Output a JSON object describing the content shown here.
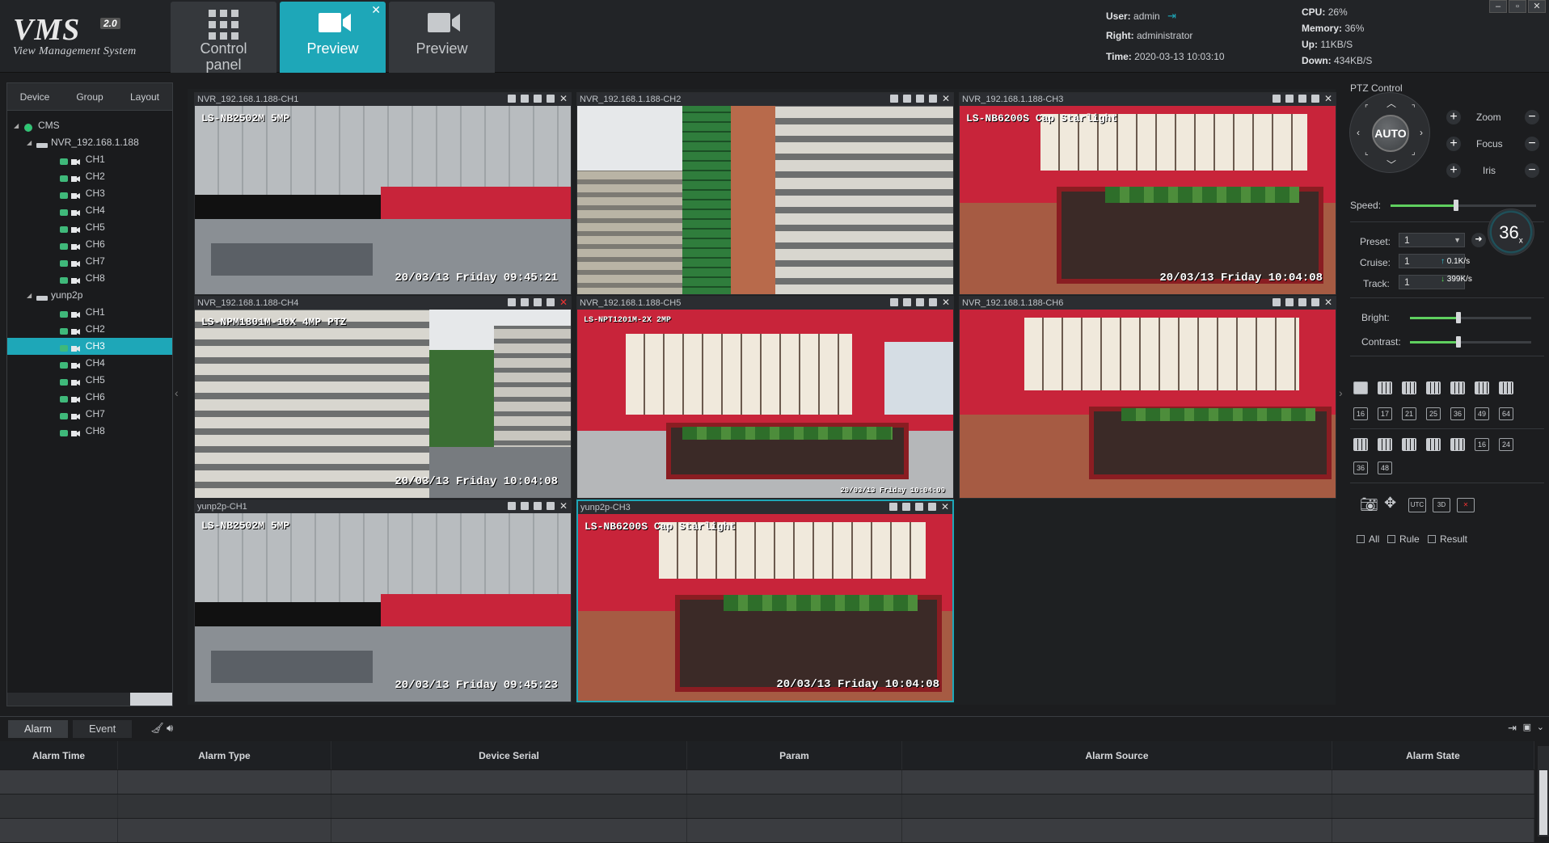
{
  "app": {
    "logo_main": "VMS",
    "logo_version": "2.0",
    "logo_sub": "View Management System"
  },
  "nav": {
    "tabs": [
      {
        "label": "Control panel",
        "icon": "grid-icon"
      },
      {
        "label": "Preview",
        "icon": "camera-icon",
        "active": true,
        "closable": true
      },
      {
        "label": "Preview",
        "icon": "camera-icon"
      }
    ]
  },
  "session": {
    "user_label": "User:",
    "user_value": "admin",
    "right_label": "Right:",
    "right_value": "administrator",
    "time_label": "Time:",
    "time_value": "2020-03-13 10:03:10"
  },
  "stats": {
    "cpu_label": "CPU:",
    "cpu_value": "26%",
    "memory_label": "Memory:",
    "memory_value": "36%",
    "up_label": "Up:",
    "up_value": "11KB/S",
    "down_label": "Down:",
    "down_value": "434KB/S"
  },
  "left_panel": {
    "tabs": [
      "Device",
      "Group",
      "Layout"
    ],
    "tree": {
      "root": "CMS",
      "devices": [
        {
          "name": "NVR_192.168.1.188",
          "channels": [
            "CH1",
            "CH2",
            "CH3",
            "CH4",
            "CH5",
            "CH6",
            "CH7",
            "CH8"
          ]
        },
        {
          "name": "yunp2p",
          "channels": [
            "CH1",
            "CH2",
            "CH3",
            "CH4",
            "CH5",
            "CH6",
            "CH7",
            "CH8"
          ],
          "selected": "CH3"
        }
      ]
    }
  },
  "video": {
    "cells": [
      {
        "title": "NVR_192.168.1.188-CH1",
        "osd_top": "LS-NB2502M  5MP",
        "osd_time": "20/03/13 Friday 09:45:21"
      },
      {
        "title": "NVR_192.168.1.188-CH2",
        "osd_top": "",
        "osd_time": ""
      },
      {
        "title": "NVR_192.168.1.188-CH3",
        "osd_top": "LS-NB6200S Cap Starlight",
        "osd_time": "20/03/13 Friday 10:04:08"
      },
      {
        "title": "NVR_192.168.1.188-CH4",
        "osd_top": "LS-NPM1801M-10X 4MP PTZ",
        "osd_time": "20/03/13 Friday 10:04:08"
      },
      {
        "title": "NVR_192.168.1.188-CH5",
        "osd_top": "LS-NPT1201M-2X 2MP",
        "osd_time": "20/03/13 Friday 10:04:09"
      },
      {
        "title": "NVR_192.168.1.188-CH6",
        "osd_top": "",
        "osd_time": ""
      },
      {
        "title": "yunp2p-CH1",
        "osd_top": "LS-NB2502M  5MP",
        "osd_time": "20/03/13 Friday 09:45:23"
      },
      {
        "title": "yunp2p-CH3",
        "osd_top": "LS-NB6200S Cap Starlight",
        "osd_time": "20/03/13 Friday 10:04:08"
      }
    ]
  },
  "ptz": {
    "title": "PTZ Control",
    "auto_label": "AUTO",
    "zoom_label": "Zoom",
    "focus_label": "Focus",
    "iris_label": "Iris",
    "speed_label": "Speed:",
    "speed_level": 0.45,
    "preset_label": "Preset:",
    "preset_value": "1",
    "cruise_label": "Cruise:",
    "cruise_value": "1",
    "track_label": "Track:",
    "track_value": "1",
    "net_up": "0.1K/s",
    "net_down": "399K/s",
    "zoom_ratio": "36",
    "zoom_unit": "x"
  },
  "image": {
    "bright_label": "Bright:",
    "bright_level": 0.5,
    "contrast_label": "Contrast:",
    "contrast_level": 0.5
  },
  "layouts": {
    "row2": [
      "16",
      "17",
      "21",
      "25",
      "36",
      "49",
      "64"
    ],
    "row3_labels": [
      "16",
      "24"
    ],
    "row4": [
      "36",
      "48"
    ]
  },
  "tools": {
    "utc_label": "UTC",
    "threed_label": "3D"
  },
  "filters": {
    "all_label": "All",
    "rule_label": "Rule",
    "result_label": "Result"
  },
  "bottom": {
    "tabs": [
      "Alarm",
      "Event"
    ],
    "columns": [
      "Alarm Time",
      "Alarm Type",
      "Device Serial",
      "Param",
      "Alarm Source",
      "Alarm State"
    ]
  },
  "colors": {
    "accent": "#1ea7b8",
    "background": "#1c1d1f",
    "record_red": "#e33333"
  }
}
